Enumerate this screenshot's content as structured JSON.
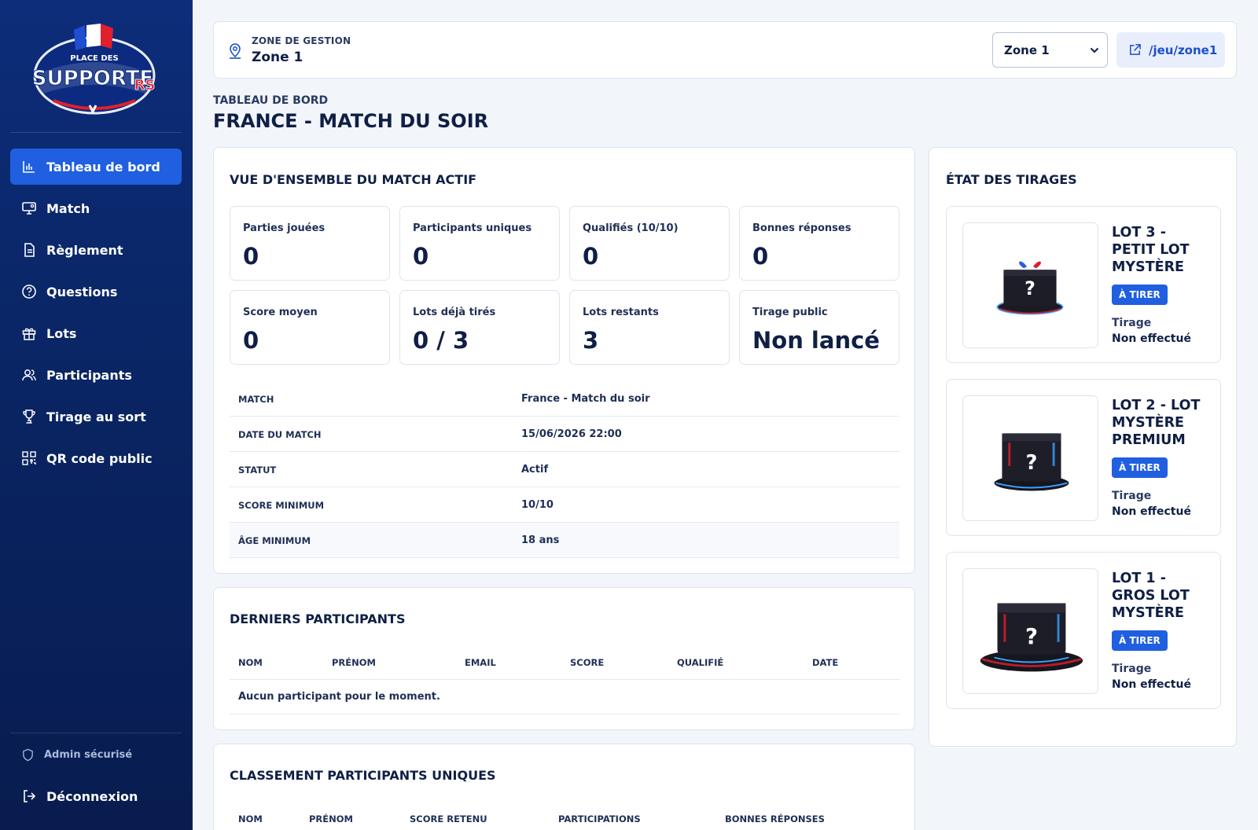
{
  "logo": {
    "top_text": "PLACE DES",
    "brand_a": "SUPPORTE",
    "brand_b": "RS"
  },
  "nav": [
    {
      "label": "Tableau de bord",
      "icon": "bar-chart-icon",
      "active": true
    },
    {
      "label": "Match",
      "icon": "monitor-icon"
    },
    {
      "label": "Règlement",
      "icon": "document-icon"
    },
    {
      "label": "Questions",
      "icon": "help-circle-icon"
    },
    {
      "label": "Lots",
      "icon": "gift-icon"
    },
    {
      "label": "Participants",
      "icon": "users-icon"
    },
    {
      "label": "Tirage au sort",
      "icon": "trophy-icon"
    },
    {
      "label": "QR code public",
      "icon": "qr-code-icon"
    }
  ],
  "sidebar_footer": {
    "admin": "Admin sécurisé",
    "logout": "Déconnexion"
  },
  "topbar": {
    "zone_label": "ZONE DE GESTION",
    "zone_value": "Zone 1",
    "zone_select": "Zone 1",
    "zone_link": "/jeu/zone1"
  },
  "page": {
    "kicker": "TABLEAU DE BORD",
    "title": "FRANCE - MATCH DU SOIR"
  },
  "overview": {
    "title": "VUE D'ENSEMBLE DU MATCH ACTIF",
    "stats": [
      {
        "label": "Parties jouées",
        "value": "0"
      },
      {
        "label": "Participants uniques",
        "value": "0"
      },
      {
        "label": "Qualifiés (10/10)",
        "value": "0"
      },
      {
        "label": "Bonnes réponses",
        "value": "0"
      },
      {
        "label": "Score moyen",
        "value": "0"
      },
      {
        "label": "Lots déjà tirés",
        "value": "0 / 3"
      },
      {
        "label": "Lots restants",
        "value": "3"
      },
      {
        "label": "Tirage public",
        "value": "Non lancé"
      }
    ],
    "info": [
      {
        "key": "MATCH",
        "value": "France - Match du soir"
      },
      {
        "key": "DATE DU MATCH",
        "value": "15/06/2026 22:00"
      },
      {
        "key": "STATUT",
        "value": "Actif"
      },
      {
        "key": "SCORE MINIMUM",
        "value": "10/10"
      },
      {
        "key": "ÂGE MINIMUM",
        "value": "18 ans"
      }
    ]
  },
  "recent": {
    "title": "DERNIERS PARTICIPANTS",
    "columns": [
      "NOM",
      "PRÉNOM",
      "EMAIL",
      "SCORE",
      "QUALIFIÉ",
      "DATE"
    ],
    "empty": "Aucun participant pour le moment."
  },
  "ranking": {
    "title": "CLASSEMENT PARTICIPANTS UNIQUES",
    "columns": [
      "NOM",
      "PRÉNOM",
      "SCORE RETENU",
      "PARTICIPATIONS",
      "BONNES RÉPONSES"
    ]
  },
  "draws": {
    "title": "ÉTAT DES TIRAGES",
    "lots": [
      {
        "title": "LOT 3 - PETIT LOT MYSTÈRE",
        "badge": "À TIRER",
        "tirage_label": "Tirage",
        "tirage_value": "Non effectué"
      },
      {
        "title": "LOT 2 - LOT MYSTÈRE PREMIUM",
        "badge": "À TIRER",
        "tirage_label": "Tirage",
        "tirage_value": "Non effectué"
      },
      {
        "title": "LOT 1 - GROS LOT MYSTÈRE",
        "badge": "À TIRER",
        "tirage_label": "Tirage",
        "tirage_value": "Non effectué"
      }
    ]
  },
  "colors": {
    "sidebar": "#0a2666",
    "accent": "#1f5fe0",
    "text": "#0f1f45",
    "background": "#f2f5fa"
  }
}
